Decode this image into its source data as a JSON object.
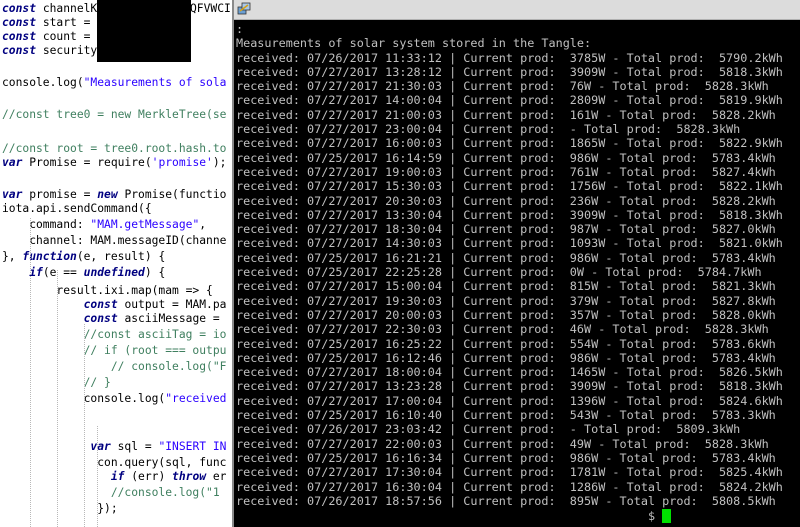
{
  "editor": {
    "lines": [
      {
        "text": "const channelK",
        "style": "decl"
      },
      {
        "text": "const start = ",
        "style": "decl"
      },
      {
        "text": "const count = ",
        "style": "decl"
      },
      {
        "text": "const security",
        "style": "decl"
      },
      {
        "text": "",
        "style": "plain"
      },
      {
        "text": "console.log(\"Measurements of sola",
        "style": "plain"
      },
      {
        "text": "",
        "style": "plain"
      },
      {
        "text": "//const tree0 = new MerkleTree(se",
        "style": "comment"
      },
      {
        "text": "",
        "style": "plain"
      },
      {
        "text": "//const root = tree0.root.hash.to",
        "style": "comment"
      },
      {
        "text": "var Promise = require('promise');",
        "style": "var"
      },
      {
        "text": "",
        "style": "plain"
      },
      {
        "text": "var promise = new Promise(functio",
        "style": "var"
      },
      {
        "text": "iota.api.sendCommand({",
        "style": "plain"
      },
      {
        "text": "    command: \"MAM.getMessage\",",
        "style": "plain"
      },
      {
        "text": "    channel: MAM.messageID(channe",
        "style": "plain"
      },
      {
        "text": "}, function(e, result) {",
        "style": "plain"
      },
      {
        "text": "    if(e == undefined) {",
        "style": "plain"
      },
      {
        "text": "        result.ixi.map(mam => {",
        "style": "plain"
      },
      {
        "text": "            const output = MAM.pa",
        "style": "decl"
      },
      {
        "text": "            const asciiMessage = ",
        "style": "decl"
      },
      {
        "text": "            //const asciiTag = io",
        "style": "comment"
      },
      {
        "text": "            // if (root === outpu",
        "style": "comment"
      },
      {
        "text": "                // console.log(\"F",
        "style": "comment"
      },
      {
        "text": "            // }",
        "style": "comment"
      },
      {
        "text": "            console.log(\"received",
        "style": "plain"
      },
      {
        "text": "",
        "style": "plain"
      },
      {
        "text": "",
        "style": "plain"
      },
      {
        "text": "             var sql = \"INSERT IN",
        "style": "var"
      },
      {
        "text": "              con.query(sql, func",
        "style": "plain"
      },
      {
        "text": "                if (err) throw er",
        "style": "plain"
      },
      {
        "text": "                //console.log(\"1",
        "style": "comment"
      },
      {
        "text": "              });",
        "style": "plain"
      }
    ],
    "top_fragment": "QFVWCI"
  },
  "terminal": {
    "title_icon": "putty-icon",
    "lines": [
      ":",
      "Measurements of solar system stored in the Tangle:",
      "received: 07/26/2017 11:33:12 | Current prod:  3785W - Total prod:  5790.2kWh",
      "received: 07/27/2017 13:28:12 | Current prod:  3909W - Total prod:  5818.3kWh",
      "received: 07/27/2017 21:30:03 | Current prod:  76W - Total prod:  5828.3kWh",
      "received: 07/27/2017 14:00:04 | Current prod:  2809W - Total prod:  5819.9kWh",
      "received: 07/27/2017 21:00:03 | Current prod:  161W - Total prod:  5828.2kWh",
      "received: 07/27/2017 23:00:04 | Current prod:  - Total prod:  5828.3kWh",
      "received: 07/27/2017 16:00:03 | Current prod:  1865W - Total prod:  5822.9kWh",
      "received: 07/25/2017 16:14:59 | Current prod:  986W - Total prod:  5783.4kWh",
      "received: 07/27/2017 19:00:03 | Current prod:  761W - Total prod:  5827.4kWh",
      "received: 07/27/2017 15:30:03 | Current prod:  1756W - Total prod:  5822.1kWh",
      "received: 07/27/2017 20:30:03 | Current prod:  236W - Total prod:  5828.2kWh",
      "received: 07/27/2017 13:30:04 | Current prod:  3909W - Total prod:  5818.3kWh",
      "received: 07/27/2017 18:30:04 | Current prod:  987W - Total prod:  5827.0kWh",
      "received: 07/27/2017 14:30:03 | Current prod:  1093W - Total prod:  5821.0kWh",
      "received: 07/25/2017 16:21:21 | Current prod:  986W - Total prod:  5783.4kWh",
      "received: 07/25/2017 22:25:28 | Current prod:  0W - Total prod:  5784.7kWh",
      "received: 07/27/2017 15:00:04 | Current prod:  815W - Total prod:  5821.3kWh",
      "received: 07/27/2017 19:30:03 | Current prod:  379W - Total prod:  5827.8kWh",
      "received: 07/27/2017 20:00:03 | Current prod:  357W - Total prod:  5828.0kWh",
      "received: 07/27/2017 22:30:03 | Current prod:  46W - Total prod:  5828.3kWh",
      "received: 07/25/2017 16:25:22 | Current prod:  554W - Total prod:  5783.6kWh",
      "received: 07/25/2017 16:12:46 | Current prod:  986W - Total prod:  5783.4kWh",
      "received: 07/27/2017 18:00:04 | Current prod:  1465W - Total prod:  5826.5kWh",
      "received: 07/27/2017 13:23:28 | Current prod:  3909W - Total prod:  5818.3kWh",
      "received: 07/27/2017 17:00:04 | Current prod:  1396W - Total prod:  5824.6kWh",
      "received: 07/25/2017 16:10:40 | Current prod:  543W - Total prod:  5783.3kWh",
      "received: 07/26/2017 23:03:42 | Current prod:  - Total prod:  5809.3kWh",
      "received: 07/27/2017 22:00:03 | Current prod:  49W - Total prod:  5828.3kWh",
      "received: 07/25/2017 16:16:34 | Current prod:  986W - Total prod:  5783.4kWh",
      "received: 07/27/2017 17:30:04 | Current prod:  1781W - Total prod:  5825.4kWh",
      "received: 07/27/2017 16:30:04 | Current prod:  1286W - Total prod:  5824.2kWh",
      "received: 07/26/2017 18:57:56 | Current prod:  895W - Total prod:  5808.5kWh"
    ],
    "prompt": "$"
  }
}
